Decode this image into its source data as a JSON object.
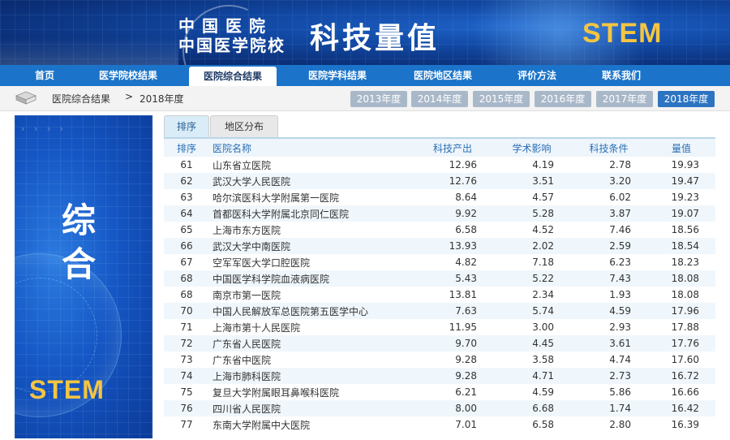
{
  "banner": {
    "line1": "中国医院",
    "line2": "中国医学院校",
    "title": "科技量值",
    "stem": "STEM"
  },
  "nav": {
    "items": [
      {
        "label": "首页"
      },
      {
        "label": "医学院校结果"
      },
      {
        "label": "医院综合结果",
        "active": true
      },
      {
        "label": "医院学科结果"
      },
      {
        "label": "医院地区结果"
      },
      {
        "label": "评价方法"
      },
      {
        "label": "联系我们"
      }
    ]
  },
  "breadcrumb": {
    "level1": "医院综合结果",
    "separator": ">",
    "level2": "2018年度"
  },
  "years": {
    "items": [
      "2013年度",
      "2014年度",
      "2015年度",
      "2016年度",
      "2017年度",
      "2018年度"
    ],
    "active": "2018年度"
  },
  "side_panel": {
    "char1": "综",
    "char2": "合",
    "stem": "STEM"
  },
  "tabs": {
    "items": [
      {
        "label": "排序",
        "active": true
      },
      {
        "label": "地区分布"
      }
    ]
  },
  "table": {
    "headers": [
      "排序",
      "医院名称",
      "科技产出",
      "学术影响",
      "科技条件",
      "量值"
    ],
    "rows": [
      [
        "61",
        "山东省立医院",
        "12.96",
        "4.19",
        "2.78",
        "19.93"
      ],
      [
        "62",
        "武汉大学人民医院",
        "12.76",
        "3.51",
        "3.20",
        "19.47"
      ],
      [
        "63",
        "哈尔滨医科大学附属第一医院",
        "8.64",
        "4.57",
        "6.02",
        "19.23"
      ],
      [
        "64",
        "首都医科大学附属北京同仁医院",
        "9.92",
        "5.28",
        "3.87",
        "19.07"
      ],
      [
        "65",
        "上海市东方医院",
        "6.58",
        "4.52",
        "7.46",
        "18.56"
      ],
      [
        "66",
        "武汉大学中南医院",
        "13.93",
        "2.02",
        "2.59",
        "18.54"
      ],
      [
        "67",
        "空军军医大学口腔医院",
        "4.82",
        "7.18",
        "6.23",
        "18.23"
      ],
      [
        "68",
        "中国医学科学院血液病医院",
        "5.43",
        "5.22",
        "7.43",
        "18.08"
      ],
      [
        "68",
        "南京市第一医院",
        "13.81",
        "2.34",
        "1.93",
        "18.08"
      ],
      [
        "70",
        "中国人民解放军总医院第五医学中心",
        "7.63",
        "5.74",
        "4.59",
        "17.96"
      ],
      [
        "71",
        "上海市第十人民医院",
        "11.95",
        "3.00",
        "2.93",
        "17.88"
      ],
      [
        "72",
        "广东省人民医院",
        "9.70",
        "4.45",
        "3.61",
        "17.76"
      ],
      [
        "73",
        "广东省中医院",
        "9.28",
        "3.58",
        "4.74",
        "17.60"
      ],
      [
        "74",
        "上海市肺科医院",
        "9.28",
        "4.71",
        "2.73",
        "16.72"
      ],
      [
        "75",
        "复旦大学附属眼耳鼻喉科医院",
        "6.21",
        "4.59",
        "5.86",
        "16.66"
      ],
      [
        "76",
        "四川省人民医院",
        "8.00",
        "6.68",
        "1.74",
        "16.42"
      ],
      [
        "77",
        "东南大学附属中大医院",
        "7.01",
        "6.58",
        "2.80",
        "16.39"
      ]
    ]
  },
  "colors": {
    "nav_bg": "#1b74c9",
    "year_active": "#2c74c2",
    "year_inactive": "#a9b8c9",
    "header_text": "#2a6fb6",
    "stem_gold": "#f5c542",
    "row_stripe": "#f0f7fc"
  }
}
